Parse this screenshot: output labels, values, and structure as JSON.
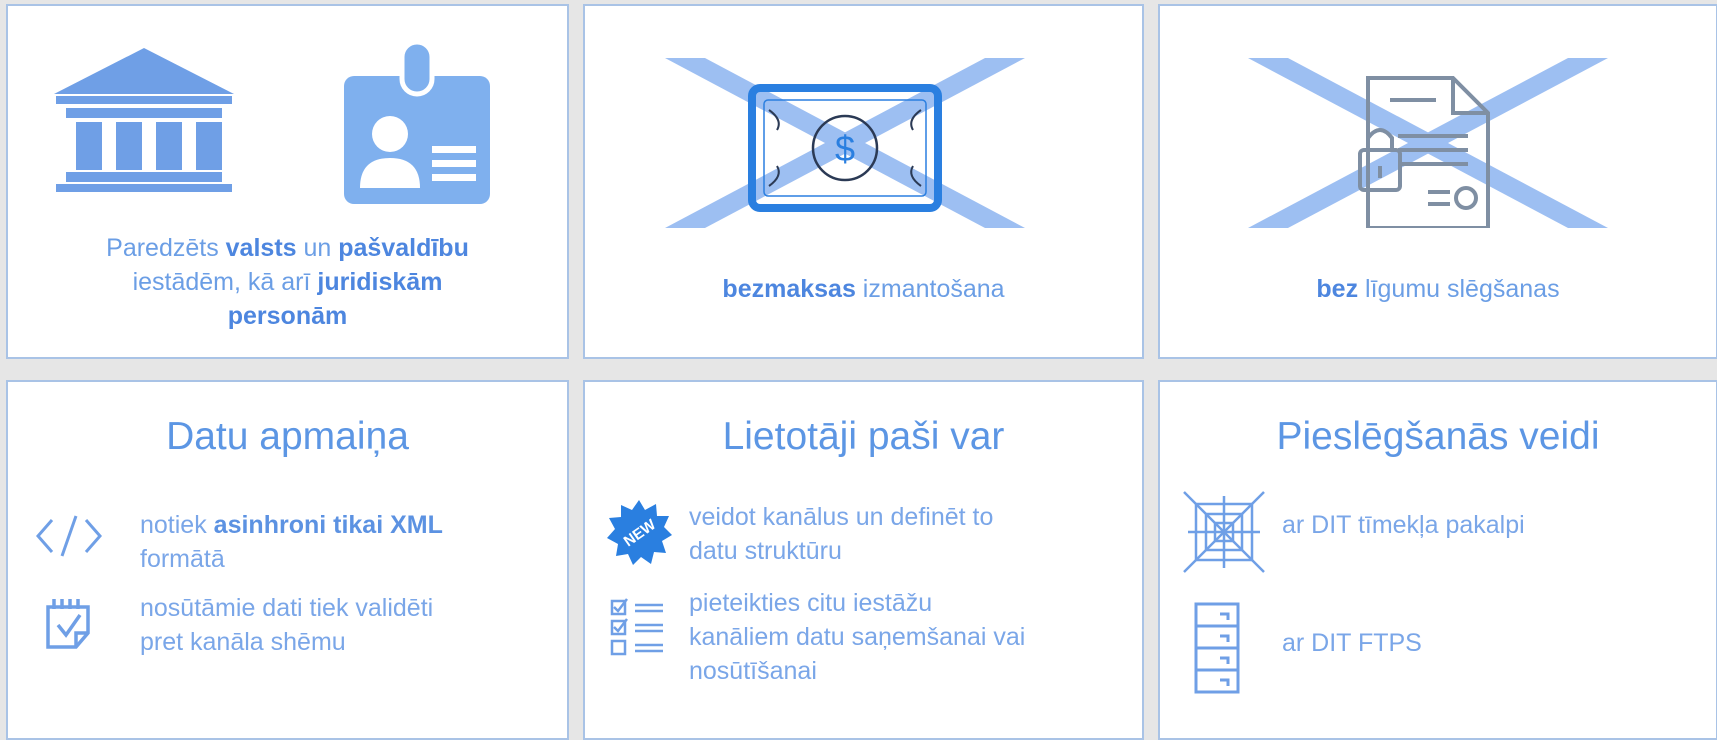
{
  "colors": {
    "background": "#e6e6e6",
    "card_border": "#a9c3e6",
    "text_blue": "#6b9ee5",
    "icon_blue": "#6f9fe6",
    "cross_blue": "#8db4f0",
    "money_blue": "#2a7fe0",
    "doc_gray": "#7f8fa3"
  },
  "card1": {
    "icons": [
      "government-building-icon",
      "id-badge-icon"
    ],
    "line1_a": "Paredzēts ",
    "line1_b": "valsts",
    "line1_c": " un ",
    "line1_d": "pašvaldību",
    "line2_a": "iestādēm, kā arī ",
    "line2_b": "juridiskām",
    "line3": "personām"
  },
  "card2": {
    "icons": [
      "money-bill-icon",
      "cross-out-icon"
    ],
    "bold": "bezmaksas",
    "rest": " izmantošana"
  },
  "card3": {
    "icons": [
      "locked-document-icon",
      "cross-out-icon"
    ],
    "bold": "bez",
    "rest": " līgumu slēgšanas"
  },
  "card4": {
    "title": "Datu apmaiņa",
    "item1": {
      "icon": "code-icon",
      "a": "notiek ",
      "b": "asinhroni tikai XML",
      "c": "formātā"
    },
    "item2": {
      "icon": "calendar-check-icon",
      "line1": "nosūtāmie dati tiek validēti",
      "line2": "pret kanāla shēmu"
    }
  },
  "card5": {
    "title": "Lietotāji paši var",
    "badge": "NEW",
    "item1": {
      "icon": "new-badge-icon",
      "line1": "veidot kanālus un definēt to",
      "line2": "datu struktūru"
    },
    "item2": {
      "icon": "checklist-icon",
      "line1": "pieteikties citu iestāžu",
      "line2": "kanāliem datu saņemšanai vai",
      "line3": "nosūtīšanai"
    }
  },
  "card6": {
    "title": "Pieslēgšanās veidi",
    "item1": {
      "icon": "web-icon",
      "label": "ar DIT tīmekļa pakalpi"
    },
    "item2": {
      "icon": "file-cabinet-icon",
      "label": "ar DIT FTPS"
    }
  }
}
